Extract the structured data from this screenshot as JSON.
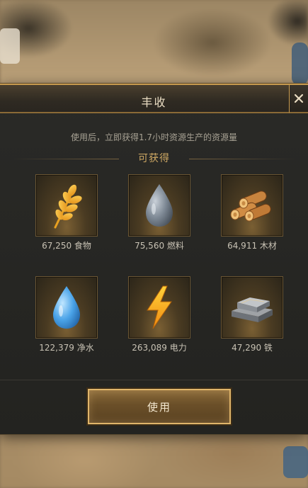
{
  "dialog": {
    "title": "丰收",
    "description": "使用后，立即获得1.7小时资源生产的资源量",
    "section_title": "可获得",
    "use_button_label": "使用"
  },
  "resources": [
    {
      "icon": "wheat-icon",
      "label": "67,250 食物"
    },
    {
      "icon": "oil-drop-icon",
      "label": "75,560 燃料"
    },
    {
      "icon": "wood-logs-icon",
      "label": "64,911 木材"
    },
    {
      "icon": "water-drop-icon",
      "label": "122,379 净水"
    },
    {
      "icon": "lightning-icon",
      "label": "263,089 电力"
    },
    {
      "icon": "iron-ingot-icon",
      "label": "47,290 铁"
    }
  ],
  "colors": {
    "accent_gold": "#c79a4e",
    "section_title": "#cfa964",
    "panel_bg": "#2a2a27"
  }
}
